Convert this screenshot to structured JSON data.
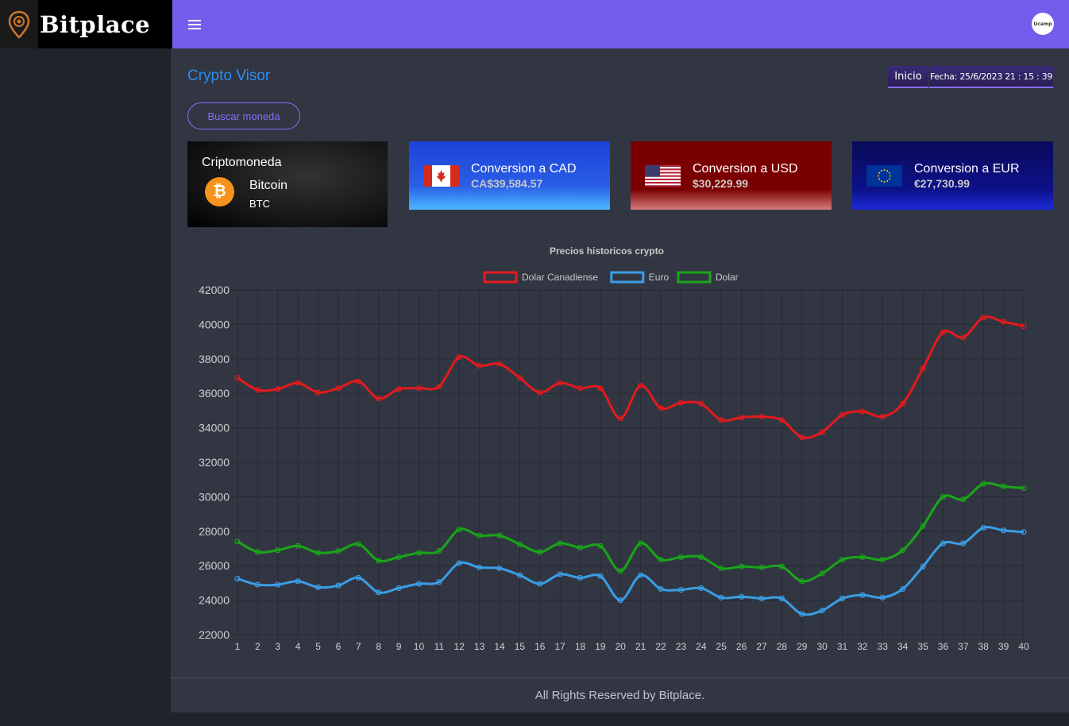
{
  "header": {
    "brand_name": "Bitplace",
    "avatar_text": "Ucamp"
  },
  "main": {
    "title": "Crypto Visor",
    "breadcrumb_home": "Inicio",
    "breadcrumb_date": "Fecha: 25/6/2023 21 : 15 : 39",
    "search_button": "Buscar moneda"
  },
  "crypto_card": {
    "heading": "Criptomoneda",
    "coin_name": "Bitcoin",
    "coin_symbol": "BTC"
  },
  "conversions": [
    {
      "title": "Conversion a CAD",
      "value": "CA$39,584.57"
    },
    {
      "title": "Conversion a USD",
      "value": "$30,229.99"
    },
    {
      "title": "Conversion a EUR",
      "value": "€27,730.99"
    }
  ],
  "colors": {
    "accent": "#735ded",
    "cad": "#e41a1c",
    "euro": "#3a9ee6",
    "dolar": "#1aa51a"
  },
  "chart_data": {
    "type": "line",
    "title": "Precios historicos crypto",
    "xlabel": "",
    "ylabel": "",
    "ylim": [
      22000,
      42000
    ],
    "grid": true,
    "legend_placement": "top-center",
    "categories": [
      "1",
      "2",
      "3",
      "4",
      "5",
      "6",
      "7",
      "8",
      "9",
      "10",
      "11",
      "12",
      "13",
      "14",
      "15",
      "16",
      "17",
      "18",
      "19",
      "20",
      "21",
      "22",
      "23",
      "24",
      "25",
      "26",
      "27",
      "28",
      "29",
      "30",
      "31",
      "32",
      "33",
      "34",
      "35",
      "36",
      "37",
      "38",
      "39",
      "40"
    ],
    "series": [
      {
        "name": "Dolar Canadiense",
        "color": "#e41a1c",
        "values": [
          36900,
          36200,
          36250,
          36600,
          36050,
          36300,
          36700,
          35700,
          36250,
          36300,
          36400,
          38100,
          37600,
          37700,
          36900,
          36050,
          36600,
          36300,
          36300,
          34550,
          36450,
          35150,
          35450,
          35400,
          34450,
          34600,
          34650,
          34450,
          33450,
          33750,
          34750,
          34950,
          34650,
          35400,
          37450,
          39550,
          39250,
          40400,
          40150,
          39900
        ]
      },
      {
        "name": "Euro",
        "color": "#3a9ee6",
        "values": [
          25250,
          24900,
          24900,
          25100,
          24750,
          24850,
          25300,
          24450,
          24700,
          24950,
          25050,
          26150,
          25900,
          25850,
          25450,
          24950,
          25500,
          25300,
          25400,
          24000,
          25450,
          24650,
          24600,
          24700,
          24150,
          24200,
          24100,
          24100,
          23200,
          23400,
          24100,
          24300,
          24150,
          24650,
          25950,
          27300,
          27300,
          28200,
          28050,
          27950
        ]
      },
      {
        "name": "Dolar",
        "color": "#1aa51a",
        "values": [
          27400,
          26800,
          26900,
          27150,
          26750,
          26850,
          27250,
          26300,
          26500,
          26750,
          26850,
          28100,
          27750,
          27750,
          27250,
          26800,
          27300,
          27050,
          27150,
          25700,
          27300,
          26350,
          26500,
          26500,
          25850,
          25950,
          25900,
          25950,
          25100,
          25550,
          26350,
          26500,
          26350,
          26900,
          28300,
          30000,
          29850,
          30750,
          30600,
          30500
        ]
      }
    ]
  },
  "footer": {
    "text": "All Rights Reserved by Bitplace."
  }
}
